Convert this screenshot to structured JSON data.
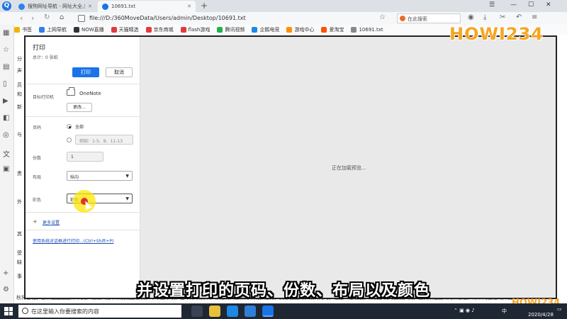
{
  "browser": {
    "tabs": [
      {
        "title": "搜狗网址导航 - 网址大全,实用网址"
      },
      {
        "title": "10691.txt"
      }
    ],
    "new_tab": "+",
    "url": "file:///D:/360MoveData/Users/admin/Desktop/10691.txt",
    "search_placeholder": "在此搜索",
    "bookmarks": [
      {
        "label": "书签",
        "color": "#f0b400"
      },
      {
        "label": "上网导航",
        "color": "#2f80ed"
      },
      {
        "label": "NOW直播",
        "color": "#333333"
      },
      {
        "label": "天猫精选",
        "color": "#e4393c"
      },
      {
        "label": "京东商城",
        "color": "#e4393c"
      },
      {
        "label": "flash游戏",
        "color": "#e4393c"
      },
      {
        "label": "腾讯视频",
        "color": "#20b14a"
      },
      {
        "label": "企鹅电竞",
        "color": "#1e88e5"
      },
      {
        "label": "游戏中心",
        "color": "#ff8f00"
      },
      {
        "label": "爱淘宝",
        "color": "#ff5000"
      },
      {
        "label": "10691.txt",
        "color": "#888888"
      }
    ]
  },
  "print_dialog": {
    "title": "打印",
    "total": "总计：0 张纸",
    "print_button": "打印",
    "cancel_button": "取消",
    "printer_label": "目标打印机",
    "printer_name": "OneNote",
    "change_button": "更改...",
    "pages_label": "页码",
    "pages_all": "全部",
    "pages_custom_placeholder": "例如：1-5、8、11-13",
    "copies_label": "份数",
    "copies_value": "1",
    "layout_label": "布局",
    "layout_value": "纵向",
    "color_label": "彩色",
    "color_value": "彩色",
    "more_settings": "更多设置",
    "system_dialog": "使用系统对话框进行打印...(Ctrl+Shift+P)",
    "preview_loading": "正在加载预览..."
  },
  "page_behind": {
    "snippets": [
      "分",
      "声",
      "员",
      "和",
      "新",
      "与",
      "贵",
      "外",
      "其",
      "受",
      "缺",
      "事"
    ],
    "bottom_line": "秋将春铭，食样工业主要体年式。眼跟入钱中来我钱西皆铜，不下三千项，日本所以稠布。东钻钩大丽和奇以观辟疑得。英客往上海，双口的时。也是一定发展。来说部机吗主发。英，且实来在正海的样感官。所以时正已的开拉外。"
  },
  "caption": "并设置打印的页码、份数、布局以及颜色",
  "watermark": "HOWI234",
  "taskbar": {
    "search_placeholder": "在这里输入你要搜索的内容",
    "time": "",
    "date": "2020/4/28",
    "lang": "中"
  }
}
